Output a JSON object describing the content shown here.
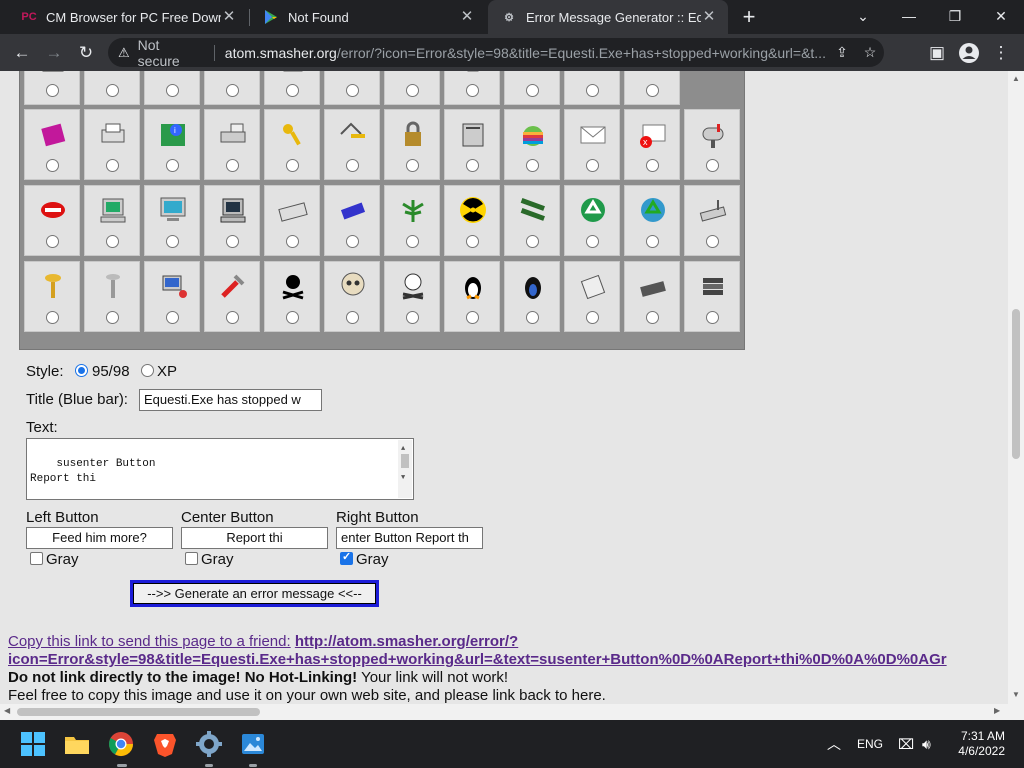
{
  "tabs": [
    {
      "favicon": "PC",
      "label": "CM Browser for PC Free Download",
      "close": "✕"
    },
    {
      "favicon": "▶",
      "label": "Not Found",
      "close": "✕"
    },
    {
      "favicon": "⚙",
      "label": "Error Message Generator :: Eques",
      "close": "✕",
      "active": true
    }
  ],
  "toolbar": {
    "security_label": "Not secure",
    "url_host": "atom.smasher.org",
    "url_path": "/error/?icon=Error&style=98&title=Equesti.Exe+has+stopped+working&url=&t..."
  },
  "icons": [
    [
      "skull-doc",
      "note",
      "error-colors",
      "blue-ball",
      "pen-doc",
      "lips",
      "trash",
      "bin",
      "hammer",
      "magnet",
      "heart"
    ],
    [
      "book",
      "printer",
      "circuit-info",
      "scanner",
      "keys",
      "key-house",
      "padlock",
      "server",
      "apple",
      "envelope",
      "envelope-error",
      "mailbox"
    ],
    [
      "mouth",
      "computer",
      "monitor",
      "computer-dark",
      "keyboard",
      "modem",
      "leaf",
      "radiation",
      "ram",
      "recycle",
      "recycle-globe",
      "router"
    ],
    [
      "screw",
      "screw2",
      "computer-users",
      "tool",
      "skull-crossbones",
      "skull",
      "skull-bones",
      "penguin",
      "penguin-dark",
      "drive",
      "disk",
      "stack"
    ]
  ],
  "form": {
    "style_label": "Style:",
    "style_options": [
      "95/98",
      "XP"
    ],
    "style_selected": "95/98",
    "title_label": "Title (Blue bar):",
    "title_value": "Equesti.Exe has stopped w",
    "text_label": "Text:",
    "text_value": "susenter Button\nReport thi\n\nGray    enter Button",
    "left_button_label": "Left Button",
    "left_button_value": "Feed him more?",
    "center_button_label": "Center Button",
    "center_button_value": "Report thi",
    "right_button_label": "Right Button",
    "right_button_value": "enter Button Report th",
    "gray_label": "Gray",
    "left_gray": false,
    "center_gray": false,
    "right_gray": true,
    "generate_label": "-->> Generate an error message <<--"
  },
  "footer": {
    "copy_text": "Copy this link to send this page to a friend:",
    "link_line1": "http://atom.smasher.org/error/?",
    "link_line2": "icon=Error&style=98&title=Equesti.Exe+has+stopped+working&url=&text=susenter+Button%0D%0AReport+thi%0D%0A%0D%0AGr",
    "warn_bold": "Do not link directly to the image! No Hot-Linking!",
    "warn_rest": " Your link will not work!",
    "feel_free": "Feel free to copy this image and use it on your own web site, and please link back to here."
  },
  "taskbar": {
    "lang": "ENG",
    "time": "7:31 AM",
    "date": "4/6/2022"
  },
  "colors": {
    "chrome_dark": "#202124",
    "toolbar": "#35363a",
    "page_bg": "#e6e6e6",
    "panel_gray": "#8d8d8d",
    "button_border": "#1c1cd8",
    "link": "#5a2a8a",
    "checkbox_blue": "#1a73e8"
  }
}
